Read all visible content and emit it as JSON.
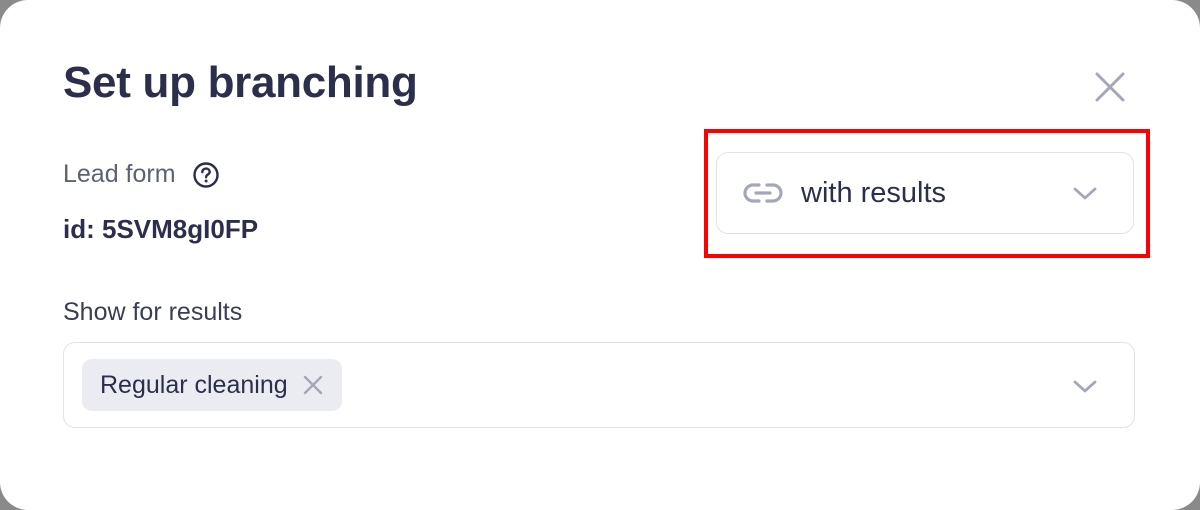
{
  "dialog": {
    "title": "Set up branching",
    "close_icon": "close-icon"
  },
  "lead_form": {
    "label": "Lead form",
    "help_icon": "question-circle-icon",
    "id_text": "id: 5SVM8gI0FP"
  },
  "link_mode_select": {
    "icon": "link-icon",
    "value": "with results",
    "chevron_icon": "chevron-down-icon"
  },
  "show_for_results": {
    "label": "Show for results",
    "selected_tags": [
      {
        "label": "Regular cleaning",
        "remove_icon": "close-icon"
      }
    ],
    "chevron_icon": "chevron-down-icon"
  },
  "colors": {
    "title": "#2b2f4c",
    "muted_text": "#5d6174",
    "border": "#e1e3e9",
    "tag_bg": "#ebecf1",
    "icon_gray": "#a3a7b7",
    "highlight": "#ff0000"
  }
}
